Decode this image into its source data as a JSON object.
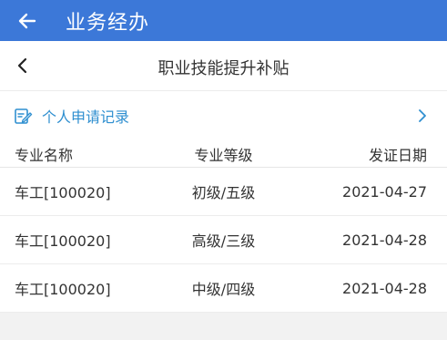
{
  "appbar": {
    "title": "业务经办"
  },
  "subbar": {
    "title": "职业技能提升补贴"
  },
  "records": {
    "label": "个人申请记录"
  },
  "table": {
    "headers": [
      "专业名称",
      "专业等级",
      "发证日期"
    ],
    "rows": [
      [
        "车工[100020]",
        "初级/五级",
        "2021-04-27"
      ],
      [
        "车工[100020]",
        "高级/三级",
        "2021-04-28"
      ],
      [
        "车工[100020]",
        "中级/四级",
        "2021-04-28"
      ]
    ]
  },
  "colors": {
    "appbar": "#3c78d8",
    "link": "#2f8fd0",
    "background": "#f2f2f2"
  },
  "icons": {
    "appbar_back": "arrow-left-icon",
    "subbar_back": "chevron-left-icon",
    "records": "edit-note-icon",
    "records_chevron": "chevron-right-icon"
  }
}
